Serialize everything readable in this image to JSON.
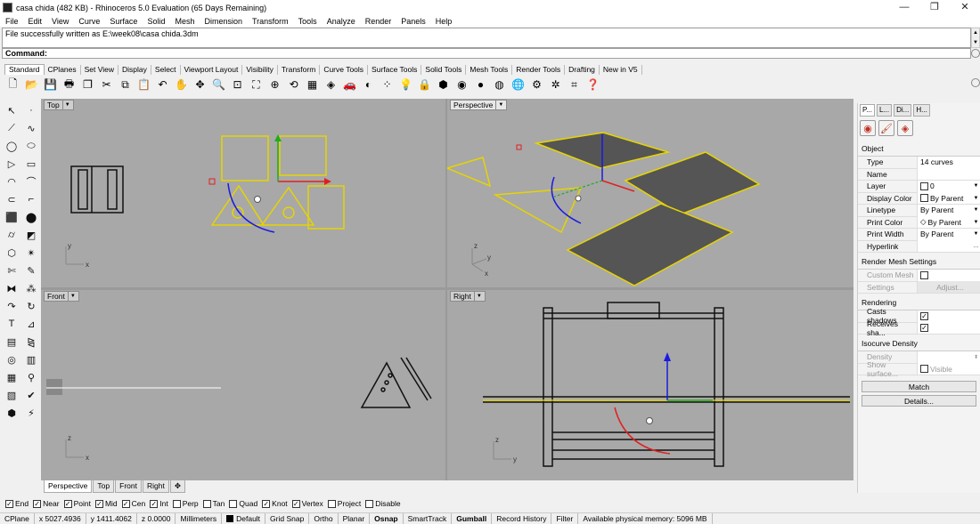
{
  "window": {
    "title": "casa chida (482 KB) - Rhinoceros 5.0 Evaluation (65 Days Remaining)",
    "minimize": "—",
    "maximize": "❐",
    "close": "✕"
  },
  "menu": [
    "File",
    "Edit",
    "View",
    "Curve",
    "Surface",
    "Solid",
    "Mesh",
    "Dimension",
    "Transform",
    "Tools",
    "Analyze",
    "Render",
    "Panels",
    "Help"
  ],
  "command": {
    "history": "File successfully written as E:\\week08\\casa chida.3dm",
    "prompt": "Command:"
  },
  "toolbar_tabs": [
    "Standard",
    "CPlanes",
    "Set View",
    "Display",
    "Select",
    "Viewport Layout",
    "Visibility",
    "Transform",
    "Curve Tools",
    "Surface Tools",
    "Solid Tools",
    "Mesh Tools",
    "Render Tools",
    "Drafting",
    "New in V5"
  ],
  "toolbar_icons": [
    "new-file-icon",
    "open-icon",
    "save-icon",
    "print-icon",
    "import-icon",
    "cut-icon",
    "copy-icon",
    "paste-icon",
    "undo-icon",
    "pan-icon",
    "rotate-icon",
    "zoom-icon",
    "zoom-window-icon",
    "zoom-extents-icon",
    "zoom-selected-icon",
    "undo-view-icon",
    "grid-viewport-icon",
    "perspective-icon",
    "car-icon",
    "shading-icon",
    "points-icon",
    "light-icon",
    "lock-icon",
    "material-icon",
    "render-color-icon",
    "render-sphere-icon",
    "render-preview-icon",
    "globe-icon",
    "settings-icon",
    "gear-icon",
    "options-icon",
    "help-icon"
  ],
  "viewports": {
    "top": "Top",
    "perspective": "Perspective",
    "front": "Front",
    "right": "Right"
  },
  "viewport_tabs": [
    "Perspective",
    "Top",
    "Front",
    "Right"
  ],
  "viewport_tab_add": "✥",
  "osnaps": [
    {
      "label": "End",
      "checked": true
    },
    {
      "label": "Near",
      "checked": true
    },
    {
      "label": "Point",
      "checked": true
    },
    {
      "label": "Mid",
      "checked": true
    },
    {
      "label": "Cen",
      "checked": true
    },
    {
      "label": "Int",
      "checked": true
    },
    {
      "label": "Perp",
      "checked": false
    },
    {
      "label": "Tan",
      "checked": false
    },
    {
      "label": "Quad",
      "checked": false
    },
    {
      "label": "Knot",
      "checked": true
    },
    {
      "label": "Vertex",
      "checked": true
    },
    {
      "label": "Project",
      "checked": false
    },
    {
      "label": "Disable",
      "checked": false
    }
  ],
  "status": {
    "cplane": "CPlane",
    "x": "x 5027.4936",
    "y": "y 1411.4062",
    "z": "z 0.0000",
    "units": "Millimeters",
    "layer": "Default",
    "grid_snap": "Grid Snap",
    "ortho": "Ortho",
    "planar": "Planar",
    "osnap": "Osnap",
    "smarttrack": "SmartTrack",
    "gumball": "Gumball",
    "record_history": "Record History",
    "filter": "Filter",
    "memory": "Available physical memory: 5096 MB"
  },
  "panel": {
    "tabs": [
      "P...",
      "L...",
      "Di...",
      "H..."
    ],
    "object_title": "Object",
    "props": [
      {
        "k": "Type",
        "v": "14 curves"
      },
      {
        "k": "Name",
        "v": ""
      },
      {
        "k": "Layer",
        "v": "0"
      },
      {
        "k": "Display Color",
        "v": "By Parent"
      },
      {
        "k": "Linetype",
        "v": "By Parent"
      },
      {
        "k": "Print Color",
        "v": "By Parent"
      },
      {
        "k": "Print Width",
        "v": "By Parent"
      },
      {
        "k": "Hyperlink",
        "v": ""
      }
    ],
    "render_mesh_title": "Render Mesh Settings",
    "custom_mesh": "Custom Mesh",
    "settings": "Settings",
    "adjust": "Adjust...",
    "rendering_title": "Rendering",
    "casts_shadows": "Casts shadows",
    "receives_shadows": "Receives sha...",
    "isocurve_title": "Isocurve Density",
    "density": "Density",
    "show_surface": "Show surface...",
    "visible": "Visible",
    "match": "Match",
    "details": "Details..."
  },
  "colors": {
    "viewport_bg": "#a8a8a8",
    "selection": "#e6d400",
    "gumball_x": "#e02020",
    "gumball_y": "#22aa22",
    "gumball_z": "#1a1ae0"
  }
}
